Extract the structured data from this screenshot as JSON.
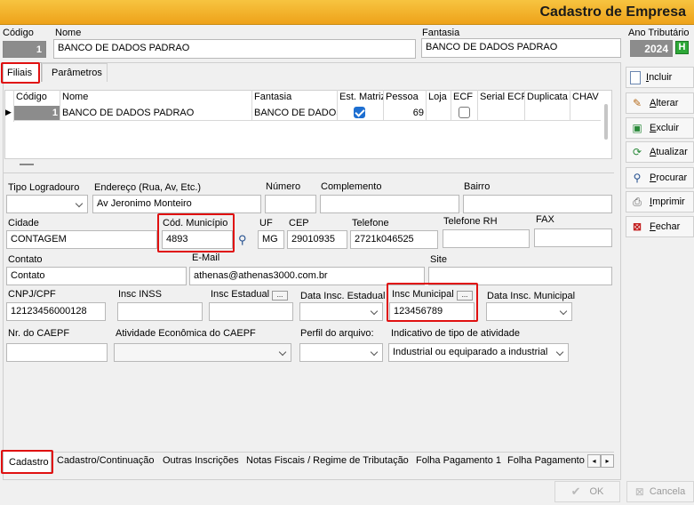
{
  "window": {
    "title": "Cadastro de Empresa"
  },
  "header": {
    "codigo_label": "Código",
    "codigo_value": "1",
    "nome_label": "Nome",
    "nome_value": "BANCO DE DADOS PADRAO",
    "fantasia_label": "Fantasia",
    "fantasia_value": "BANCO DE DADOS PADRAO",
    "ano_label": "Ano Tributário",
    "ano_value": "2024",
    "ano_badge": "H"
  },
  "top_tabs": [
    "Filiais",
    "Parâmetros"
  ],
  "grid": {
    "columns": [
      "Código",
      "Nome",
      "Fantasia",
      "Est. Matriz",
      "Pessoa",
      "Loja",
      "ECF",
      "Serial ECF",
      "Duplicata",
      "CHAV"
    ],
    "row": {
      "codigo": "1",
      "nome": "BANCO DE DADOS PADRAO",
      "fantasia": "BANCO DE DADOS",
      "est_matriz": true,
      "pessoa": "69",
      "ecf": false
    }
  },
  "form": {
    "tipo_logradouro_label": "Tipo Logradouro",
    "tipo_logradouro_value": "",
    "endereco_label": "Endereço (Rua, Av,  Etc.)",
    "endereco_value": "Av Jeronimo Monteiro",
    "numero_label": "Número",
    "numero_value": "",
    "complemento_label": "Complemento",
    "complemento_value": "",
    "bairro_label": "Bairro",
    "bairro_value": "",
    "cidade_label": "Cidade",
    "cidade_value": "CONTAGEM",
    "cod_municipio_label": "Cód. Município",
    "cod_municipio_value": "4893",
    "uf_label": "UF",
    "uf_value": "MG",
    "cep_label": "CEP",
    "cep_value": "29010935",
    "telefone_label": "Telefone",
    "telefone_value": "2721k046525",
    "telefone_rh_label": "Telefone RH",
    "telefone_rh_value": "",
    "fax_label": "FAX",
    "fax_value": "",
    "contato_label": "Contato",
    "contato_value": "Contato",
    "email_label": "E-Mail",
    "email_value": "athenas@athenas3000.com.br",
    "site_label": "Site",
    "site_value": "",
    "cnpj_label": "CNPJ/CPF",
    "cnpj_value": "12123456000128",
    "inss_label": "Insc INSS",
    "inss_value": "",
    "insc_estadual_label": "Insc Estadual",
    "insc_estadual_value": "",
    "data_insc_estadual_label": "Data Insc. Estadual",
    "insc_municipal_label": "Insc Municipal",
    "insc_municipal_value": "123456789",
    "data_insc_municipal_label": "Data Insc. Municipal",
    "caepf_label": "Nr. do CAEPF",
    "caepf_value": "",
    "atividade_caepf_label": "Atividade Econômica do CAEPF",
    "atividade_caepf_value": "",
    "perfil_label": "Perfil do arquivo:",
    "perfil_value": "",
    "indicativo_label": "Indicativo de tipo de atividade",
    "indicativo_value": "Industrial ou equiparado a industrial",
    "dots": "..."
  },
  "bottom_tabs": [
    "Cadastro",
    "Cadastro/Continuação",
    "Outras Inscrições",
    "Notas Fiscais / Regime de Tributação",
    "Folha Pagamento 1",
    "Folha Pagamento"
  ],
  "side_buttons": [
    {
      "key": "I",
      "rest": "ncluir",
      "icon": "document-icon"
    },
    {
      "key": "A",
      "rest": "lterar",
      "icon": "edit-icon"
    },
    {
      "key": "E",
      "rest": "xcluir",
      "icon": "delete-icon"
    },
    {
      "key": "A",
      "rest": "tualizar",
      "icon": "refresh-icon"
    },
    {
      "key": "P",
      "rest": "rocurar",
      "icon": "binoculars-icon"
    },
    {
      "key": "I",
      "rest": "mprimir",
      "icon": "printer-icon"
    },
    {
      "key": "F",
      "rest": "echar",
      "icon": "close-icon"
    }
  ],
  "footer": {
    "ok_label": "OK",
    "cancel_label": "Cancela"
  },
  "colors": {
    "accent": "#eea21a",
    "highlight": "#e01010",
    "check": "#1e6fd1"
  }
}
